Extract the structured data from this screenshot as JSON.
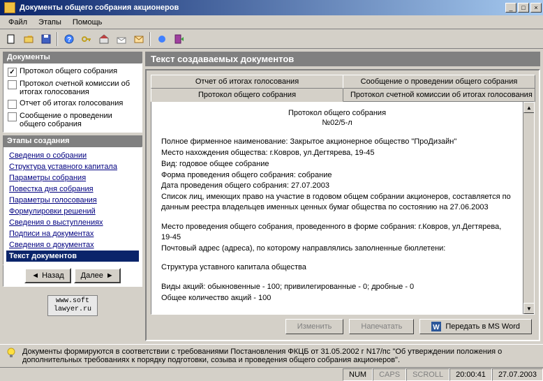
{
  "window": {
    "title": "Документы общего собрания акционеров"
  },
  "menu": {
    "file": "Файл",
    "stages": "Этапы",
    "help": "Помощь"
  },
  "left": {
    "docs_header": "Документы",
    "docs": [
      {
        "label": "Протокол общего собрания",
        "checked": true
      },
      {
        "label": "Протокол счетной комиссии об итогах голосования",
        "checked": false
      },
      {
        "label": "Отчет об итогах голосования",
        "checked": false
      },
      {
        "label": "Сообщение о проведении общего собрания",
        "checked": false
      }
    ],
    "stages_header": "Этапы создания",
    "stages": [
      "Сведения о собрании",
      "Структура уставного капитала",
      "Параметры собрания",
      "Повестка дня собрания",
      "Параметры голосования",
      "Формулировки решений",
      "Сведения о выступлениях",
      "Подписи на документах",
      "Сведения о документах",
      "Текст документов"
    ],
    "selected_stage_index": 9,
    "back": "Назад",
    "next": "Далее",
    "site_line1": "www.soft",
    "site_line2": "lawyer.ru"
  },
  "right": {
    "header": "Текст создаваемых документов",
    "tabs_row1": [
      "Отчет об итогах голосования",
      "Сообщение о проведении общего собрания"
    ],
    "tabs_row2": [
      "Протокол общего собрания",
      "Протокол счетной комиссии об итогах голосования"
    ],
    "active_tab_index": 0,
    "doc": {
      "title": "Протокол общего собрания",
      "subtitle": "№02/5-л",
      "lines": [
        "Полное фирменное наименование: Закрытое акционерное общество \"ПроДизайн\"",
        "Место нахождения общества: г.Ковров, ул.Дегтярева, 19-45",
        "Вид: годовое общее собрание",
        "Форма проведения общего собрания: собрание",
        "Дата проведения общего собрания: 27.07.2003",
        "Список лиц, имеющих право на участие в годовом общем собрании акционеров, составляется по данным реестра владельцев именных ценных бумаг общества по состоянию на 27.06.2003",
        "",
        "Место проведения общего собрания, проведенного в форме собрания: г.Ковров, ул.Дегтярева, 19-45",
        "Почтовый адрес (адреса), по которому направлялись заполненные бюллетени:",
        "",
        "Структура уставного капитала общества",
        "",
        "Виды акций: обыкновенные - 100; привилегированные - 0; дробные - 0",
        "Общее количество акций - 100"
      ]
    },
    "buttons": {
      "edit": "Изменить",
      "print": "Напечатать",
      "export": "Передать в MS Word"
    }
  },
  "hint": "Документы формируются в соответствии с требованиями Постановления ФКЦБ от 31.05.2002 г N17/пс \"Об утверждении положения о дополнительных требованиях к порядку подготовки, созыва и проведения общего собрания акционеров\".",
  "status": {
    "num": "NUM",
    "caps": "CAPS",
    "scroll": "SCROLL",
    "time": "20:00:41",
    "date": "27.07.2003"
  }
}
